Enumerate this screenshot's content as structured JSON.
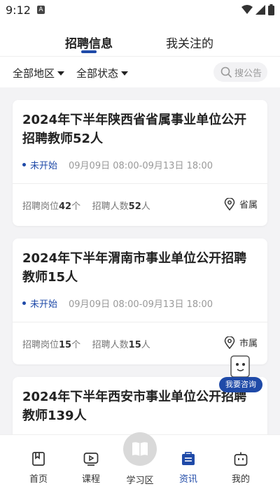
{
  "status_bar": {
    "time": "9:12",
    "sim_label": "A"
  },
  "tabs": [
    {
      "label": "招聘信息",
      "active": true
    },
    {
      "label": "我关注的",
      "active": false
    }
  ],
  "filters": {
    "region": "全部地区",
    "status": "全部状态"
  },
  "search": {
    "placeholder": "搜公告"
  },
  "cards": [
    {
      "title": "2024年下半年陕西省省属事业单位公开招聘教师52人",
      "status": "未开始",
      "time_range": "09月09日 08:00-09月13日 18:00",
      "positions_label": "招聘岗位",
      "positions_count": "42",
      "positions_unit": "个",
      "people_label": "招聘人数",
      "people_count": "52",
      "people_unit": "人",
      "location": "省属"
    },
    {
      "title": "2024年下半年渭南市事业单位公开招聘教师15人",
      "status": "未开始",
      "time_range": "09月09日 08:00-09月13日 18:00",
      "positions_label": "招聘岗位",
      "positions_count": "15",
      "positions_unit": "个",
      "people_label": "招聘人数",
      "people_count": "15",
      "people_unit": "人",
      "location": "市属"
    },
    {
      "title": "2024年下半年西安市事业单位公开招聘教师139人"
    }
  ],
  "consult_button": {
    "label": "我要咨询"
  },
  "bottom_nav": [
    {
      "label": "首页",
      "icon": "home-book-icon"
    },
    {
      "label": "课程",
      "icon": "play-icon"
    },
    {
      "label": "学习区",
      "icon": "open-book-icon"
    },
    {
      "label": "资讯",
      "icon": "news-icon",
      "active": true
    },
    {
      "label": "我的",
      "icon": "robot-face-icon"
    }
  ],
  "colors": {
    "accent": "#1f4aa8",
    "background": "#f3f3f5"
  }
}
